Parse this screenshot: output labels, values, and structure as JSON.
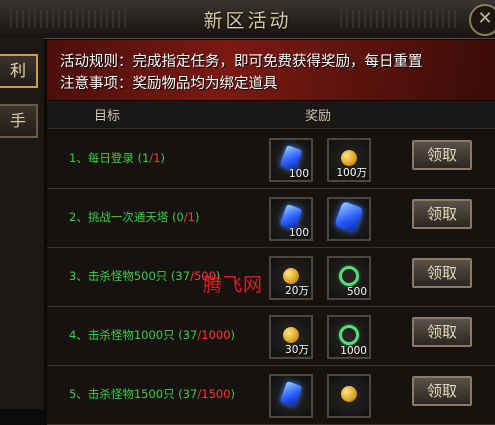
{
  "window": {
    "title": "新区活动",
    "close_glyph": "✕"
  },
  "side_tabs": [
    {
      "label": "利",
      "active": true
    },
    {
      "label": "手",
      "active": false
    }
  ],
  "banner": {
    "rules_line": "活动规则：完成指定任务，即可免费获得奖励，每日重置",
    "notice_line": "注意事项：奖励物品均为绑定道具"
  },
  "header": {
    "target": "目标",
    "reward": "奖励"
  },
  "tasks": [
    {
      "label": "1、每日登录  (",
      "current": "1",
      "sep": "/",
      "total": "1",
      "close": ")",
      "rewards": [
        {
          "icon": "blue-gem-icon",
          "qty": "100"
        },
        {
          "icon": "gold-coin-icon",
          "qty": "100万"
        }
      ],
      "button": "领取"
    },
    {
      "label": "2、挑战一次通天塔  (",
      "current": "0",
      "sep": "/",
      "total": "1",
      "close": ")",
      "rewards": [
        {
          "icon": "blue-gem-icon",
          "qty": "100"
        },
        {
          "icon": "blue-crystal-icon",
          "qty": ""
        }
      ],
      "button": "领取"
    },
    {
      "label": "3、击杀怪物500只  (",
      "current": "37",
      "sep": "/",
      "total": "500",
      "close": ")",
      "rewards": [
        {
          "icon": "gold-coin-icon",
          "qty": "20万"
        },
        {
          "icon": "green-ring-icon",
          "qty": "500"
        }
      ],
      "button": "领取"
    },
    {
      "label": "4、击杀怪物1000只  (",
      "current": "37",
      "sep": "/",
      "total": "1000",
      "close": ")",
      "rewards": [
        {
          "icon": "gold-coin-icon",
          "qty": "30万"
        },
        {
          "icon": "green-ring-icon",
          "qty": "1000"
        }
      ],
      "button": "领取"
    },
    {
      "label": "5、击杀怪物1500只  (",
      "current": "37",
      "sep": "/",
      "total": "1500",
      "close": ")",
      "rewards": [
        {
          "icon": "blue-gem-icon",
          "qty": ""
        },
        {
          "icon": "gold-coin-icon",
          "qty": ""
        }
      ],
      "button": "领取"
    }
  ],
  "watermark": "腾飞网",
  "colors": {
    "complete": "#3fcf3f",
    "target_total": "#ff3b2e",
    "banner": "#7a1a12"
  }
}
